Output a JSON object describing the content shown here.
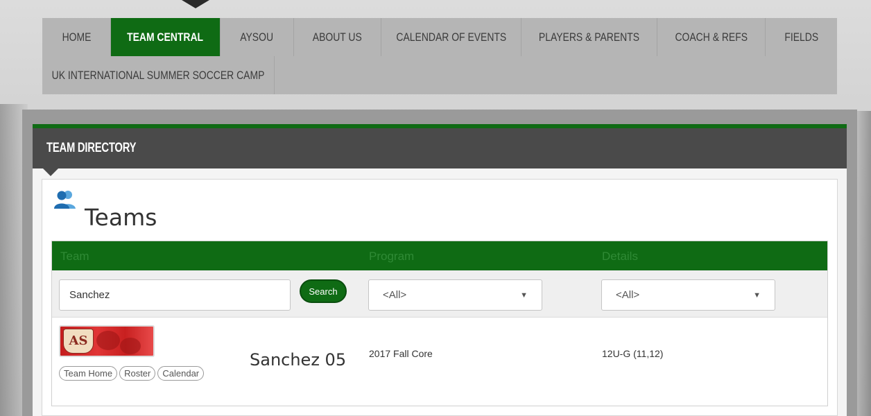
{
  "nav": {
    "row1": [
      {
        "label": "HOME",
        "active": false
      },
      {
        "label": "TEAM CENTRAL",
        "active": true
      },
      {
        "label": "AYSOU",
        "active": false
      },
      {
        "label": "ABOUT US",
        "active": false
      },
      {
        "label": "CALENDAR OF EVENTS",
        "active": false
      },
      {
        "label": "PLAYERS & PARENTS",
        "active": false
      },
      {
        "label": "COACH & REFS",
        "active": false
      },
      {
        "label": "FIELDS",
        "active": false
      }
    ],
    "row2": [
      {
        "label": "UK INTERNATIONAL SUMMER SOCCER CAMP",
        "active": false
      }
    ]
  },
  "directory": {
    "title": "TEAM DIRECTORY",
    "heading": "Teams",
    "icon": "users-icon"
  },
  "table": {
    "columns": [
      "Team",
      "Program",
      "Details"
    ],
    "search": {
      "value": "Sanchez",
      "button_label": "Search"
    },
    "program_filter": "<All>",
    "details_filter": "<All>",
    "rows": [
      {
        "team_name": "Sanchez 05",
        "program": "2017 Fall Core",
        "details": "12U-G (11,12)",
        "logo_text": "AS",
        "links": [
          "Team Home",
          "Roster",
          "Calendar"
        ]
      }
    ]
  },
  "colors": {
    "brand_green": "#0f6b14",
    "header_dark": "#4a4a4a",
    "nav_bg": "#b5b5b5",
    "icon_blue": "#2a7fc0"
  }
}
